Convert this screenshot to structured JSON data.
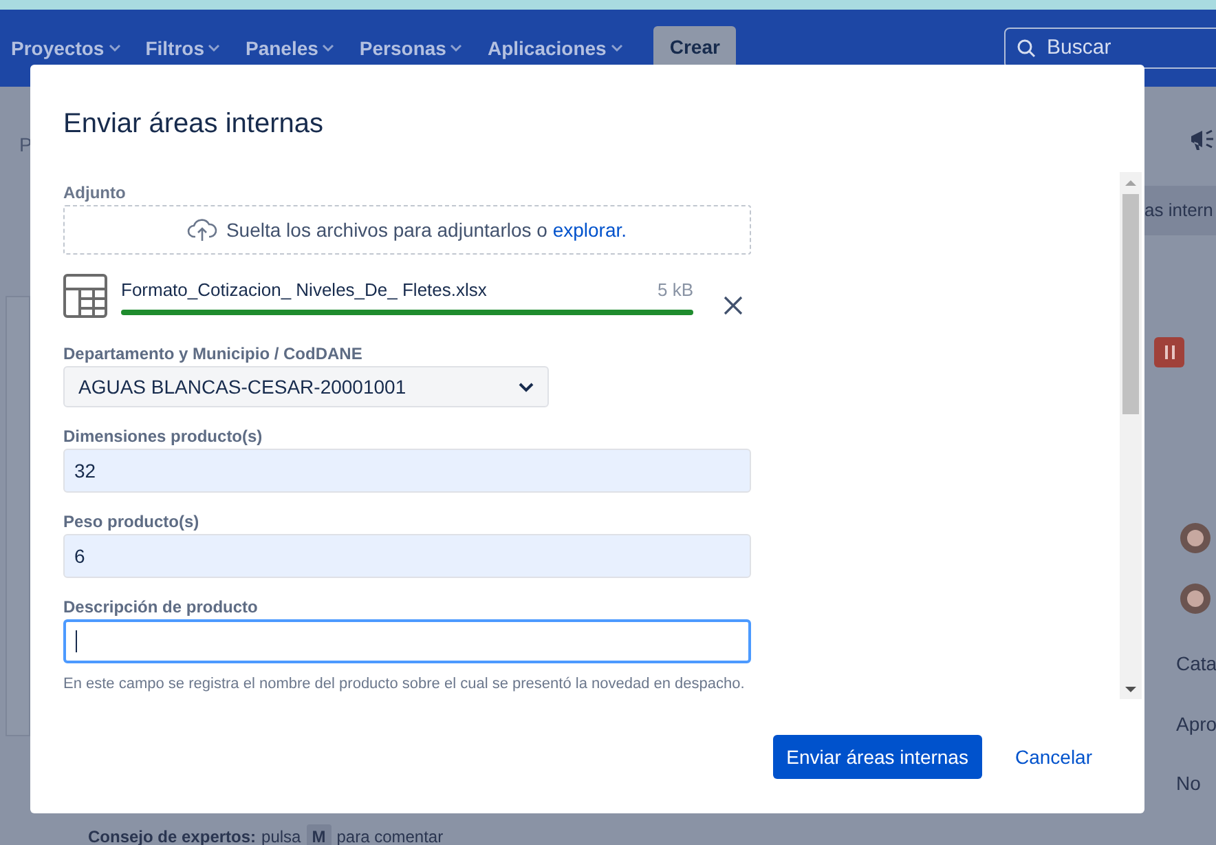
{
  "nav": {
    "items": [
      {
        "label": "Proyectos"
      },
      {
        "label": "Filtros"
      },
      {
        "label": "Paneles"
      },
      {
        "label": "Personas"
      },
      {
        "label": "Aplicaciones"
      }
    ],
    "create_button": "Crear",
    "search": {
      "placeholder": "Buscar"
    }
  },
  "background": {
    "left_texts": [
      "P"
    ],
    "tip": {
      "label": "Consejo de expertos:",
      "before": "pulsa",
      "key": "M",
      "after": "para comentar"
    },
    "right_tab": "as intern",
    "right_values": [
      "Cata",
      "Apro",
      "No"
    ]
  },
  "dialog": {
    "title": "Enviar áreas internas",
    "attachment": {
      "label": "Adjunto",
      "drop_text": "Suelta los archivos para adjuntarlos o",
      "browse_link": "explorar.",
      "file": {
        "name": "Formato_Cotizacion_ Niveles_De_ Fletes.xlsx",
        "size": "5 kB",
        "level": 1
      }
    },
    "fields": [
      {
        "kind": "select",
        "label": "Departamento y Municipio / CodDANE",
        "value": "AGUAS BLANCAS-CESAR-20001001",
        "focused": false
      },
      {
        "kind": "text",
        "label": "Dimensiones producto(s)",
        "value": "32",
        "focused": false
      },
      {
        "kind": "text",
        "label": "Peso producto(s)",
        "value": "6",
        "focused": false
      },
      {
        "kind": "text",
        "label": "Descripción de producto",
        "focused": true,
        "help": "En este campo se registra el nombre del producto sobre el cual se presentó la novedad en despacho."
      }
    ],
    "buttons": {
      "submit": "Enviar áreas internas",
      "cancel": "Cancelar"
    }
  }
}
